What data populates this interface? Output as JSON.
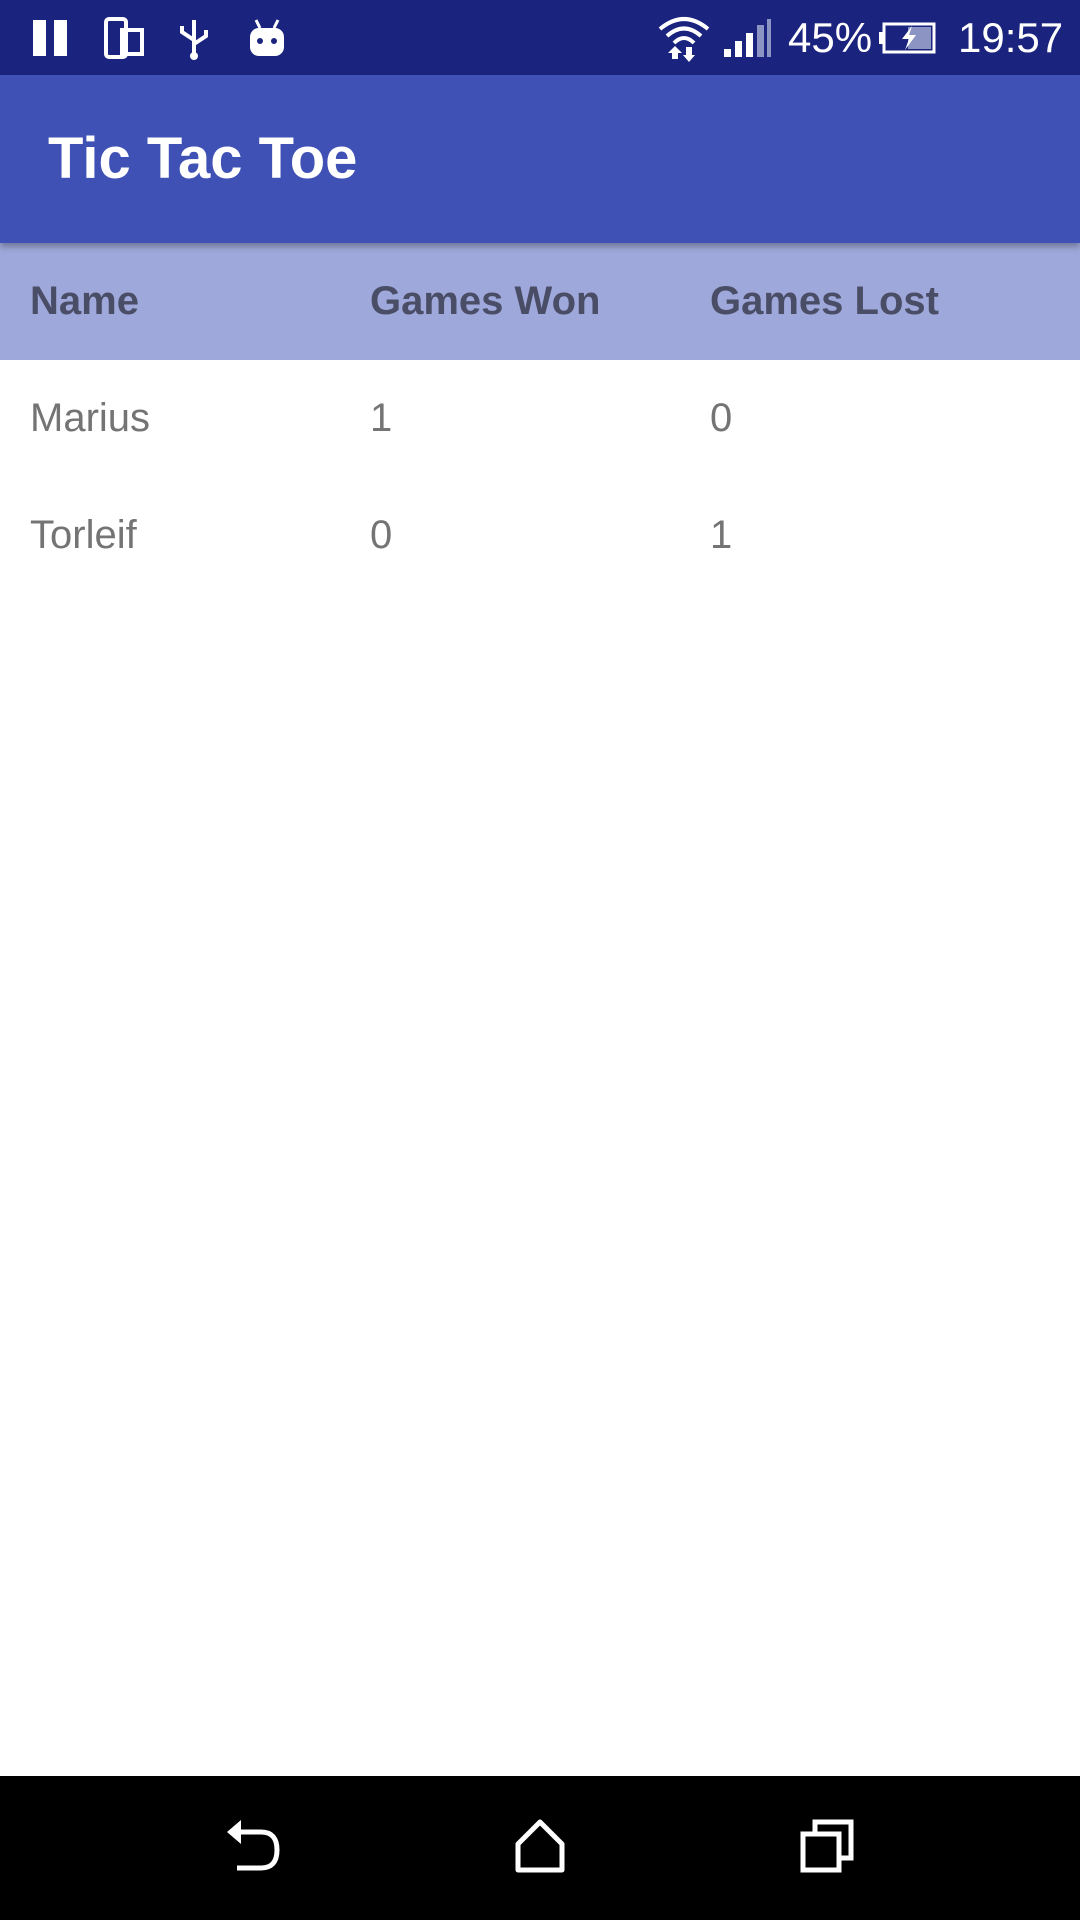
{
  "status_bar": {
    "battery_percent": "45%",
    "time": "19:57",
    "left_icons": [
      "pause-icon",
      "device-rotate-icon",
      "usb-icon",
      "android-debug-icon"
    ],
    "right_icons": [
      "wifi-icon",
      "cell-signal-icon",
      "battery-charging-icon"
    ]
  },
  "app_bar": {
    "title": "Tic Tac Toe"
  },
  "table": {
    "headers": [
      "Name",
      "Games Won",
      "Games Lost"
    ],
    "rows": [
      [
        "Marius",
        "1",
        "0"
      ],
      [
        "Torleif",
        "0",
        "1"
      ]
    ]
  },
  "nav_bar": {
    "buttons": [
      "back-icon",
      "home-icon",
      "recents-icon"
    ]
  },
  "colors": {
    "status_bar": "#1a237e",
    "app_bar": "#3f51b5",
    "table_header": "#9fa8da",
    "header_text": "#4a4d66",
    "body_text": "#747474",
    "nav_bar": "#000000"
  }
}
